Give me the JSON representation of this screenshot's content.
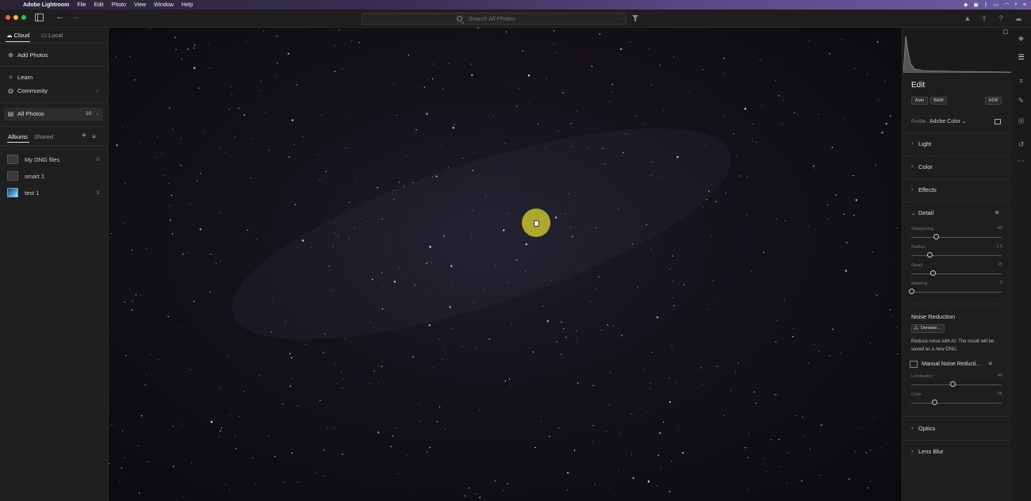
{
  "menubar": {
    "app_name": "Adobe Lightroom",
    "items": [
      "File",
      "Edit",
      "Photo",
      "View",
      "Window",
      "Help"
    ]
  },
  "toolbar": {
    "search_placeholder": "Search All Photos"
  },
  "left_panel": {
    "tabs": {
      "cloud": "Cloud",
      "local": "Local"
    },
    "add_photos": "Add Photos",
    "learn": "Learn",
    "community": "Community",
    "all_photos": {
      "label": "All Photos",
      "count": "10"
    },
    "album_tabs": {
      "albums": "Albums",
      "shared": "Shared"
    },
    "albums": [
      {
        "name": "My DNG files",
        "count": "0"
      },
      {
        "name": "smart 1",
        "count": ""
      },
      {
        "name": "test 1",
        "count": "3"
      }
    ]
  },
  "edit_panel": {
    "title": "Edit",
    "buttons": {
      "auto": "Auto",
      "bw": "B&W",
      "hdr": "HDR"
    },
    "profile_label": "Profile",
    "profile_value": "Adobe Color",
    "sections": {
      "light": "Light",
      "color": "Color",
      "effects": "Effects",
      "detail": "Detail",
      "optics": "Optics",
      "lens_blur": "Lens Blur"
    },
    "detail_sliders": [
      {
        "label": "Sharpening",
        "value": "40",
        "fraction": 0.27
      },
      {
        "label": "Radius",
        "value": "1.0",
        "fraction": 0.2
      },
      {
        "label": "Detail",
        "value": "25",
        "fraction": 0.24
      },
      {
        "label": "Masking",
        "value": "0",
        "fraction": 0.0
      }
    ],
    "noise_reduction": {
      "title": "Noise Reduction",
      "denoise_button": "Denoise...",
      "description": "Reduce noise with AI. The result will be saved as a new DNG.",
      "manual_label": "Manual Noise Reducti...",
      "sliders": [
        {
          "label": "Luminance",
          "value": "46",
          "fraction": 0.46
        },
        {
          "label": "Color",
          "value": "25",
          "fraction": 0.25
        }
      ]
    }
  },
  "colors": {
    "cursor_highlight": "#dcd728",
    "background": "#1a1a1a"
  }
}
